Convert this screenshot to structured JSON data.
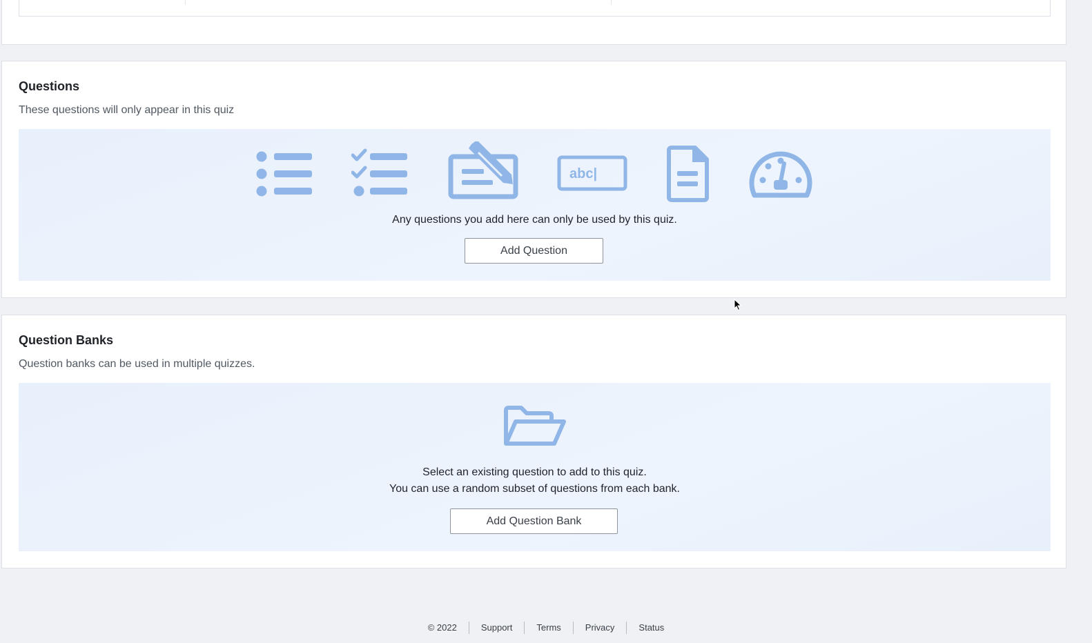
{
  "questions_section": {
    "title": "Questions",
    "subtitle": "These questions will only appear in this quiz",
    "question_type_icons": [
      "bulleted-list-icon",
      "checklist-icon",
      "essay-pencil-icon",
      "text-input-abc-icon",
      "document-icon",
      "gauge-icon"
    ],
    "text_input_icon_label": "abc|",
    "panel_text": "Any questions you add here can only be used by this quiz.",
    "add_button_label": "Add Question"
  },
  "banks_section": {
    "title": "Question Banks",
    "subtitle": "Question banks can be used in multiple quizzes.",
    "icon": "open-folder-icon",
    "panel_text_line1": "Select an existing question to add to this quiz.",
    "panel_text_line2": "You can use a random subset of questions from each bank.",
    "add_button_label": "Add Question Bank"
  },
  "footer": {
    "copyright": "© 2022",
    "links": [
      "Support",
      "Terms",
      "Privacy",
      "Status"
    ]
  },
  "colors": {
    "icon_blue": "#8fb6e6",
    "panel_bg": "#e8f0fb",
    "page_bg": "#eff1f5"
  }
}
